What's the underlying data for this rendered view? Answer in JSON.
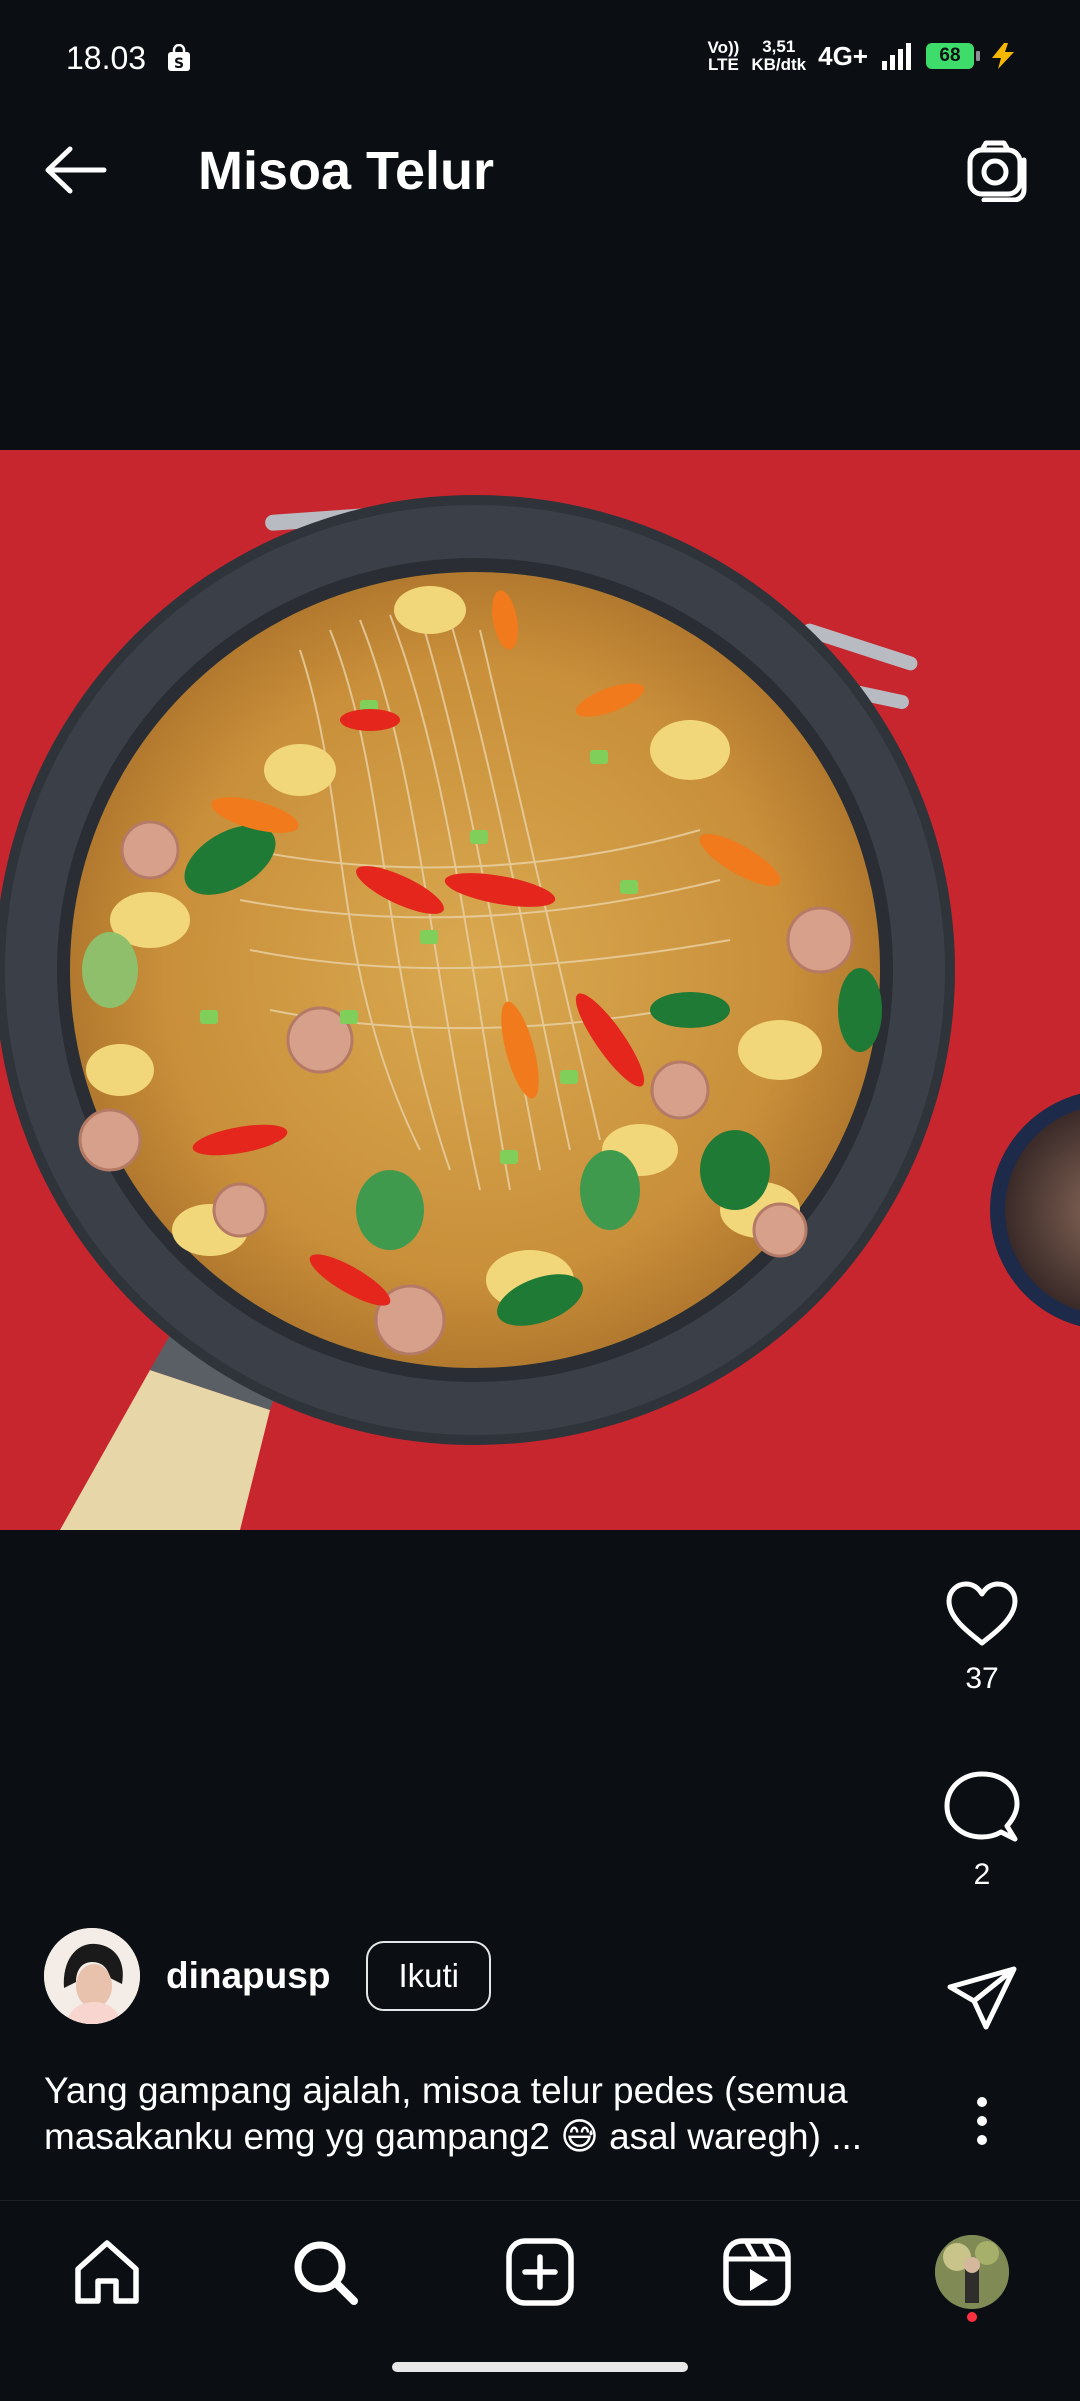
{
  "status_bar": {
    "time": "18.03",
    "volte_top": "Vo))",
    "volte_bottom": "LTE",
    "speed_value": "3,51",
    "speed_unit": "KB/dtk",
    "network": "4G+",
    "battery": "68"
  },
  "header": {
    "title": "Misoa Telur"
  },
  "post": {
    "likes": "37",
    "comments": "2",
    "username": "dinapusp",
    "follow_label": "Ikuti",
    "caption_line1": "Yang gampang ajalah, misoa telur pedes (semua",
    "caption_line2": "masakanku emg yg gampang2 😅 asal waregh) ..."
  },
  "icons": [
    "back-arrow-icon",
    "camera-icon",
    "heart-icon",
    "comment-icon",
    "share-icon",
    "more-icon",
    "home-icon",
    "search-icon",
    "create-icon",
    "reels-icon"
  ],
  "colors": {
    "background": "#0b0f14",
    "table_red": "#c8262e",
    "notification_dot": "#ff3040",
    "battery_green": "#3ddc6b"
  }
}
